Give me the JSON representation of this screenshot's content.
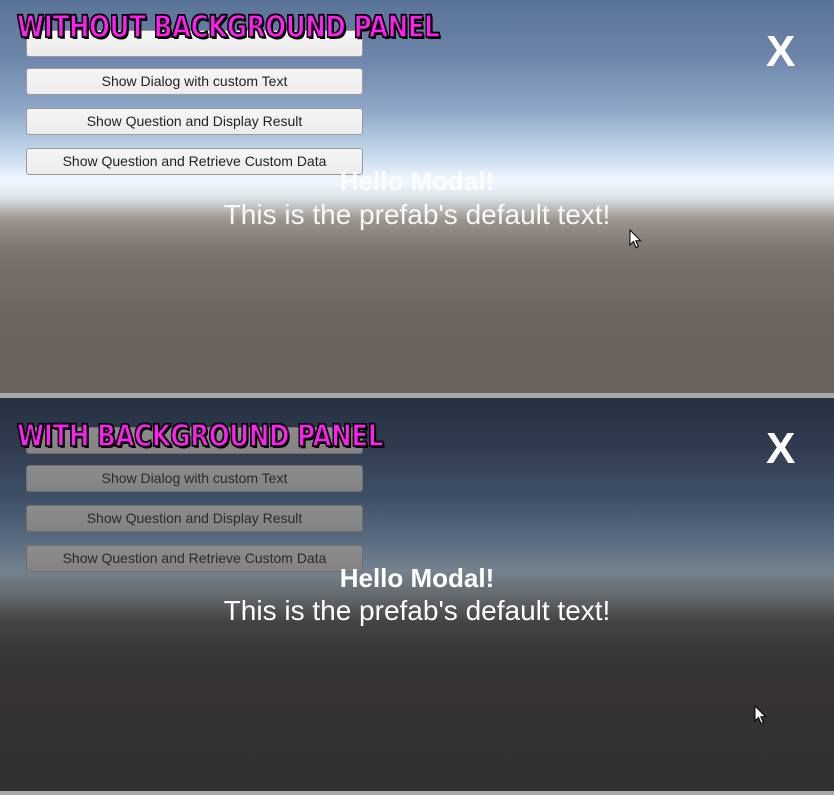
{
  "top_panel": {
    "badge": "Without Background Panel",
    "close_label": "X",
    "buttons": [
      "Show Dialog with custom Text",
      "Show Question and Display Result",
      "Show Question and Retrieve Custom Data"
    ],
    "modal_title": "Hello Modal!",
    "modal_text": "This is the prefab's default text!"
  },
  "bottom_panel": {
    "badge": "With Background Panel",
    "close_label": "X",
    "buttons": [
      "Show Dialog with custom Text",
      "Show Question and Display Result",
      "Show Question and Retrieve Custom Data"
    ],
    "modal_title": "Hello Modal!",
    "modal_text": "This is the prefab's default text!"
  },
  "colors": {
    "badge": "#ff1ff0",
    "text": "#ffffff"
  },
  "icons": [
    "mouse-cursor-icon",
    "close-icon"
  ]
}
